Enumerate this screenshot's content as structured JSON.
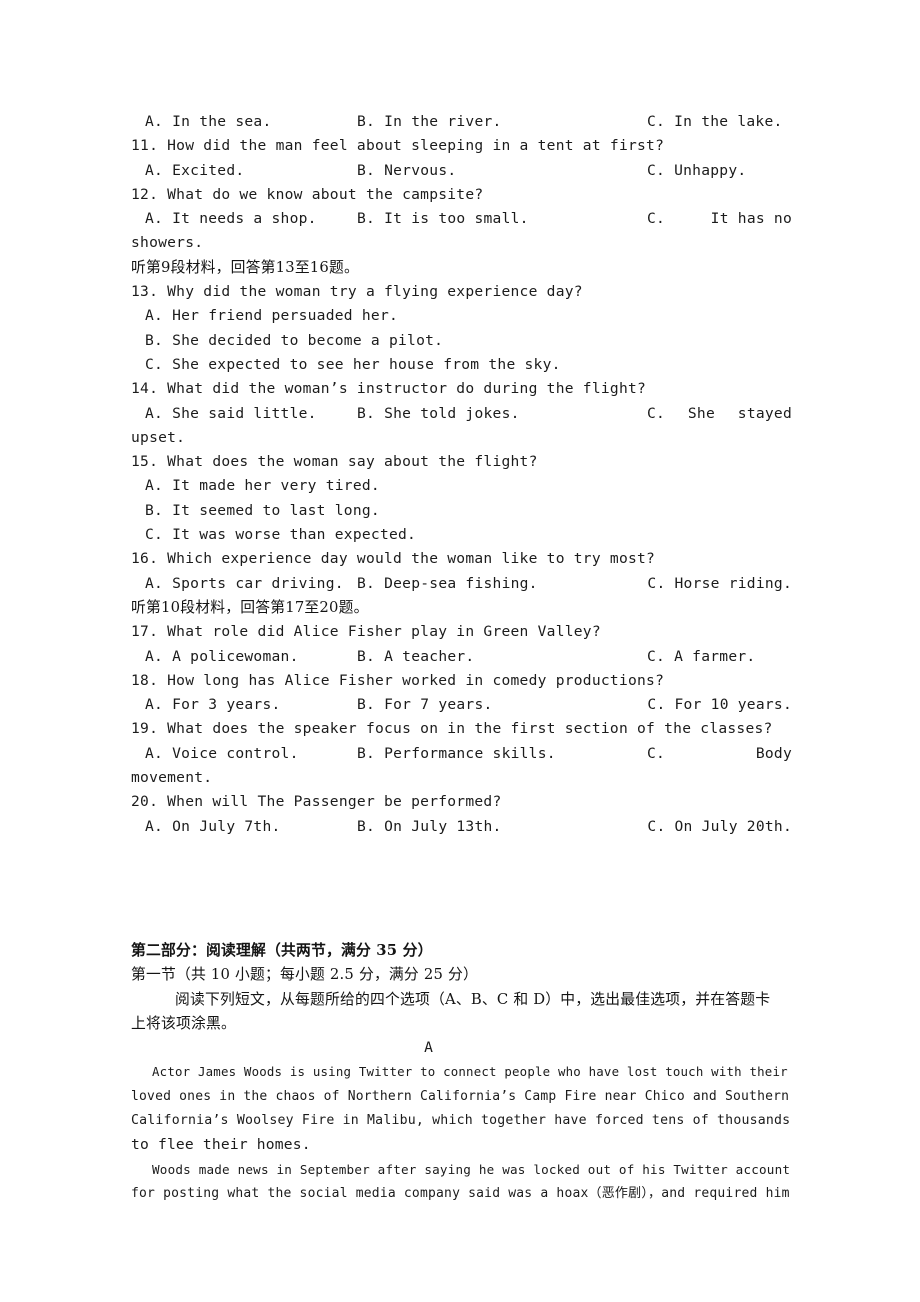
{
  "document": {
    "type": "english-exam-paper",
    "page_background": "#ffffff",
    "text_color": "#1b1b1b"
  },
  "listening": {
    "q10_options": {
      "a": "A. In the sea.",
      "b": "B. In the river.",
      "c": "C. In the lake."
    },
    "q11": {
      "stem": "11. How did the man feel about sleeping in a tent at first?",
      "a": "A. Excited.",
      "b": "B. Nervous.",
      "c": "C. Unhappy."
    },
    "q12": {
      "stem": "12. What do we know about the campsite?",
      "a": "A. It needs a shop.",
      "b": "B. It is too small.",
      "c_head": "C.",
      "c_tail": "It has no",
      "c_wrap": "showers."
    },
    "prompt9": "听第9段材料，回答第13至16题。",
    "q13": {
      "stem": "13. Why did the woman try a flying experience day?",
      "a": "A. Her friend persuaded her.",
      "b": "B. She decided to become a pilot.",
      "c": "C. She expected to see her house from the sky."
    },
    "q14": {
      "stem": "14. What did the woman’s instructor do during the flight?",
      "a": "A. She said little.",
      "b": "B. She told jokes.",
      "c_head": "C.",
      "c_mid": "She",
      "c_tail": "stayed",
      "c_wrap": "upset."
    },
    "q15": {
      "stem": "15. What does the woman say about the flight?",
      "a": "A. It made her very tired.",
      "b": "B. It seemed to last long.",
      "c": "C. It was worse than expected."
    },
    "q16": {
      "stem": "16. Which experience day would the woman like to try most?",
      "a": "A. Sports car driving.",
      "b": "B. Deep-sea fishing.",
      "c": "C. Horse riding."
    },
    "prompt10": "听第10段材料，回答第17至20题。",
    "q17": {
      "stem": "17. What role did Alice Fisher play in Green Valley?",
      "a": "A. A policewoman.",
      "b": "B. A teacher.",
      "c": "C. A farmer."
    },
    "q18": {
      "stem": "18. How long has Alice Fisher worked in comedy productions?",
      "a": "A. For 3 years.",
      "b": "B. For 7 years.",
      "c": "C. For 10 years."
    },
    "q19": {
      "stem": "19. What does the speaker focus on in the first section of the classes?",
      "a": "A. Voice control.",
      "b": "B. Performance skills.",
      "c_head": "C.",
      "c_tail": "Body",
      "c_wrap": "movement."
    },
    "q20": {
      "stem": "20. When will The Passenger be performed?",
      "a": "A. On July 7th.",
      "b": "B. On July 13th.",
      "c": "C. On July 20th."
    }
  },
  "part_two": {
    "heading": "第二部分：阅读理解（共两节，满分 35 分）",
    "section_one": "第一节（共 10 小题；每小题 2.5 分，满分 25 分）",
    "instruction_line1": "阅读下列短文，从每题所给的四个选项（A、B、C 和 D）中，选出最佳选项，并在答题卡",
    "instruction_line2": "上将该项涂黑。",
    "passage_letter": "A",
    "passage_a": {
      "p1_l1_indent": "Actor James Woods is using Twitter to connect people who have lost touch with their",
      "p1_l2": "loved ones in the chaos of Northern California’s Camp Fire near Chico and Southern",
      "p1_l3": "California’s Woolsey Fire in Malibu, which together have forced tens of thousands",
      "p1_l4": "to flee their homes.",
      "p2_l1": "Woods made news in September after saying he was locked out of his Twitter account",
      "p2_l2": "for posting what the social media company said was a hoax（恶作剧），and required him"
    }
  }
}
